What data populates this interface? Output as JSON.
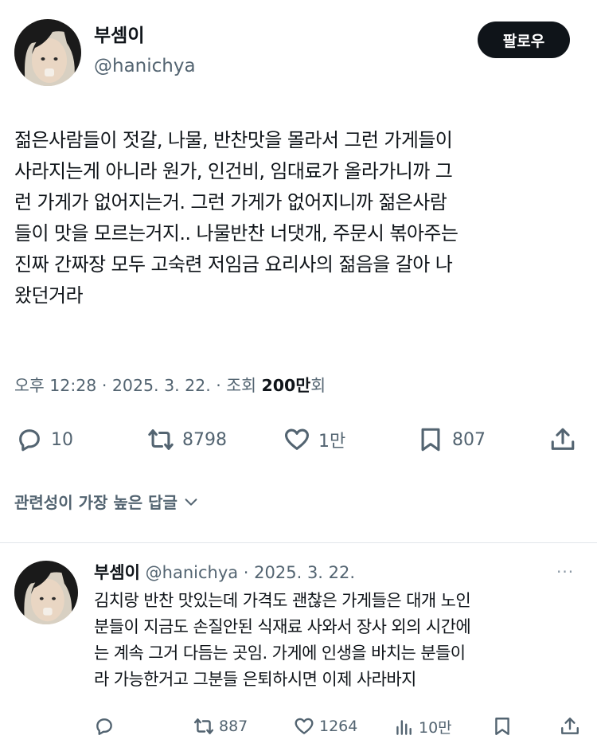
{
  "tweet": {
    "author_name": "부셈이",
    "author_handle": "@hanichya",
    "follow_label": "팔로우",
    "body_lines": [
      "젊은사람들이 젓갈, 나물, 반찬맛을 몰라서 그런 가게들이",
      "사라지는게 아니라 원가, 인건비, 임대료가 올라가니까 그",
      "런 가게가 없어지는거. 그런 가게가 없어지니까 젊은사람",
      "들이 맛을 모르는거지.. 나물반찬 너댓개, 주문시 볶아주는",
      "진짜 간짜장 모두 고숙련 저임금 요리사의 젊음을 갈아 나",
      "왔던거라"
    ],
    "meta_prefix": "오후 12:28 · 2025. 3. 22. · 조회 ",
    "views_number": "200만",
    "views_suffix": "회",
    "counts": {
      "replies": "10",
      "retweets": "8798",
      "likes": "1만",
      "bookmarks": "807"
    }
  },
  "sort_label": "관련성이 가장 높은 답글",
  "reply": {
    "author_name": "부셈이",
    "handle_date": "@hanichya · 2025. 3. 22.",
    "more_label": "···",
    "body_lines": [
      "김치랑 반찬 맛있는데 가격도 괜찮은 가게들은 대개 노인",
      "분들이 지금도 손질안된 식재료 사와서 장사 외의 시간에",
      "는 계속 그거 다듬는 곳임. 가게에 인생을 바치는 분들이",
      "라 가능한거고 그분들 은퇴하시면 이제 사라바지"
    ],
    "counts": {
      "retweets": "887",
      "likes": "1264",
      "views": "10만"
    }
  },
  "icons": {
    "reply": "speech-bubble-icon",
    "retweet": "retweet-arrows-icon",
    "like": "heart-icon",
    "bookmark": "bookmark-icon",
    "share": "share-upload-icon",
    "views": "bar-chart-icon",
    "sort": "chevron-down-icon"
  },
  "colors": {
    "text_primary": "#0f1419",
    "text_secondary": "#536471",
    "follow_bg": "#0f1419",
    "divider": "#e1e6ea"
  }
}
